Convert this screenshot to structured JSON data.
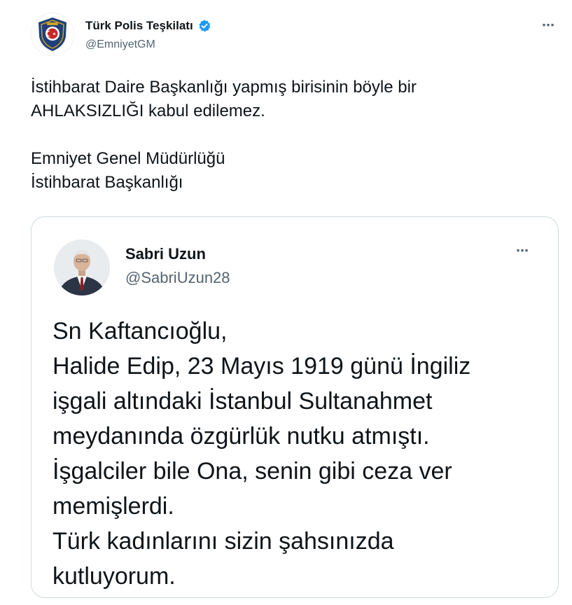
{
  "tweet": {
    "author": {
      "name": "Türk Polis Teşkilatı",
      "handle": "@EmniyetGM",
      "verified": true,
      "avatar_icon": "police-badge-icon"
    },
    "more_icon": "⋯",
    "text_lines": [
      "İstihbarat Daire Başkanlığı yapmış birisinin böyle bir",
      "AHLAKSIZLIĞI kabul edilemez."
    ],
    "signature_lines": [
      "Emniyet Genel Müdürlüğü",
      "İstihbarat Başkanlığı"
    ]
  },
  "quoted_tweet": {
    "author": {
      "name": "Sabri Uzun",
      "handle": "@SabriUzun28",
      "avatar_icon": "profile-photo-icon"
    },
    "more_icon": "⋯",
    "text_lines": [
      "Sn Kaftancıoğlu,",
      "Halide Edip, 23 Mayıs 1919 günü İngiliz",
      "işgali altındaki İstanbul Sultanahmet",
      "meydanında özgürlük nutku atmıştı.",
      "İşgalciler bile Ona, senin gibi ceza ver",
      "memişlerdi.",
      "Türk kadınlarını sizin şahsınızda",
      "kutluyorum."
    ]
  },
  "colors": {
    "text": "#0f1419",
    "secondary": "#536471",
    "verified": "#1d9bf0",
    "border": "#cfd9de",
    "badge_blue": "#1f3f7a"
  }
}
